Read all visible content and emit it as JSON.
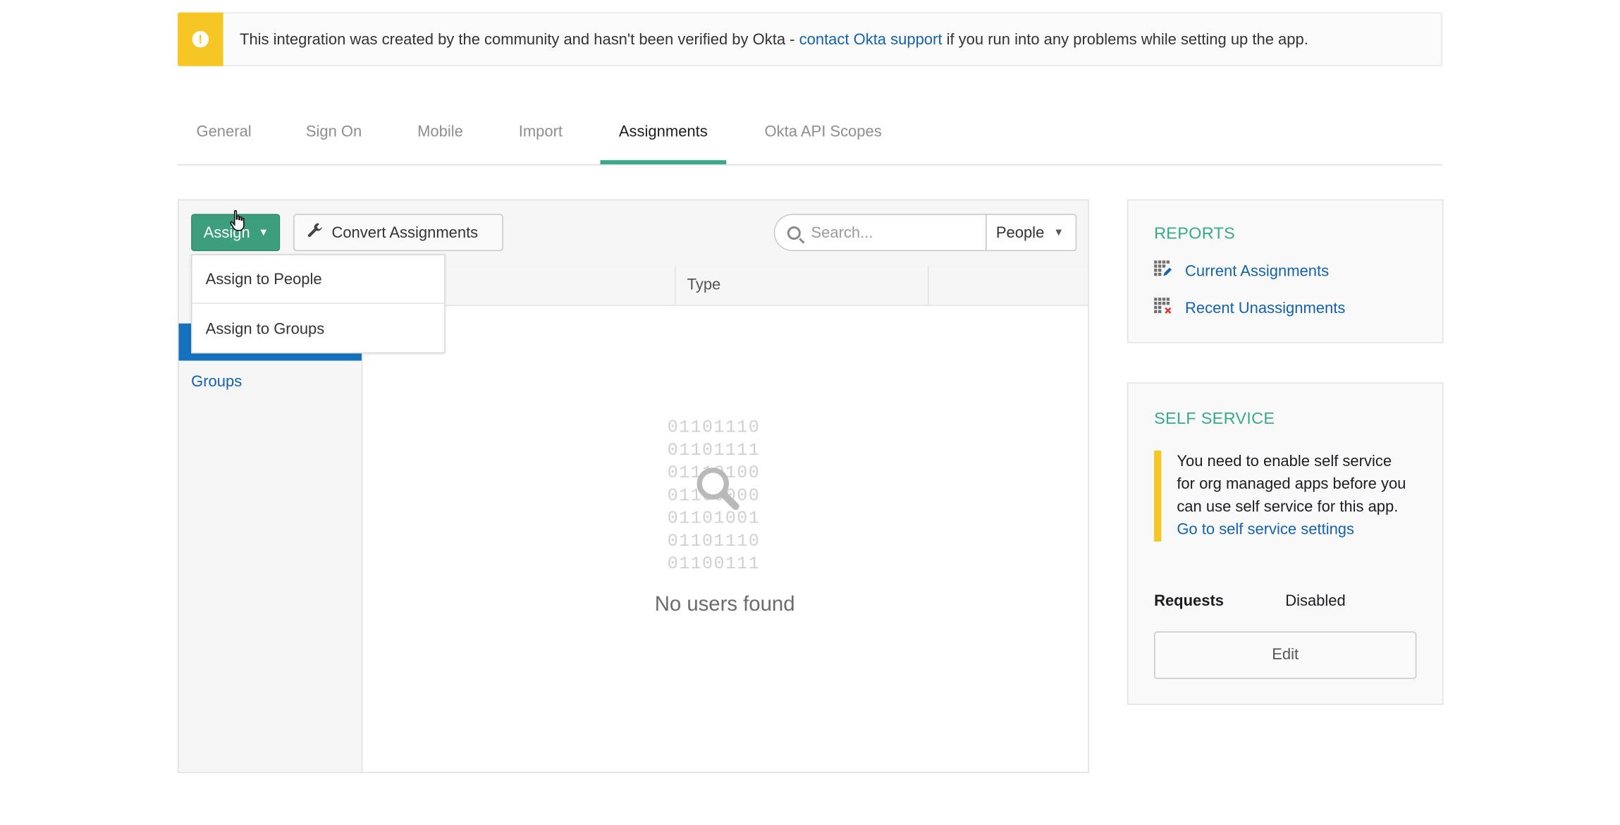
{
  "banner": {
    "icon": "warning-icon",
    "text_before": "This integration was created by the community and hasn't been verified by Okta - ",
    "link": "contact Okta support",
    "text_after": " if you run into any problems while setting up the app."
  },
  "tabs": [
    {
      "label": "General",
      "active": false
    },
    {
      "label": "Sign On",
      "active": false
    },
    {
      "label": "Mobile",
      "active": false
    },
    {
      "label": "Import",
      "active": false
    },
    {
      "label": "Assignments",
      "active": true
    },
    {
      "label": "Okta API Scopes",
      "active": false
    }
  ],
  "toolbar": {
    "assign_label": "Assign",
    "convert_label": "Convert Assignments",
    "search_placeholder": "Search...",
    "filter_value": "People"
  },
  "assign_menu": {
    "items": [
      "Assign to People",
      "Assign to Groups"
    ]
  },
  "sidebar": {
    "groups_label": "Groups"
  },
  "table": {
    "columns": [
      "",
      "Type",
      ""
    ]
  },
  "empty_state": {
    "binary_lines": [
      "01101110",
      "01101111",
      "01110100",
      "01100000",
      "01101001",
      "01101110",
      "01100111"
    ],
    "message": "No users found"
  },
  "reports": {
    "title": "REPORTS",
    "links": [
      {
        "label": "Current Assignments",
        "icon": "report-grid-edit-icon"
      },
      {
        "label": "Recent Unassignments",
        "icon": "report-grid-remove-icon"
      }
    ]
  },
  "self_service": {
    "title": "SELF SERVICE",
    "notice": "You need to enable self service for org managed apps before you can use self service for this app.",
    "notice_link": "Go to self service settings",
    "requests_label": "Requests",
    "requests_value": "Disabled",
    "edit_label": "Edit"
  },
  "colors": {
    "accent_green": "#3d9e7d",
    "link_blue": "#1662a8",
    "warning_yellow": "#f5c624",
    "sidebar_active_blue": "#1671be"
  }
}
